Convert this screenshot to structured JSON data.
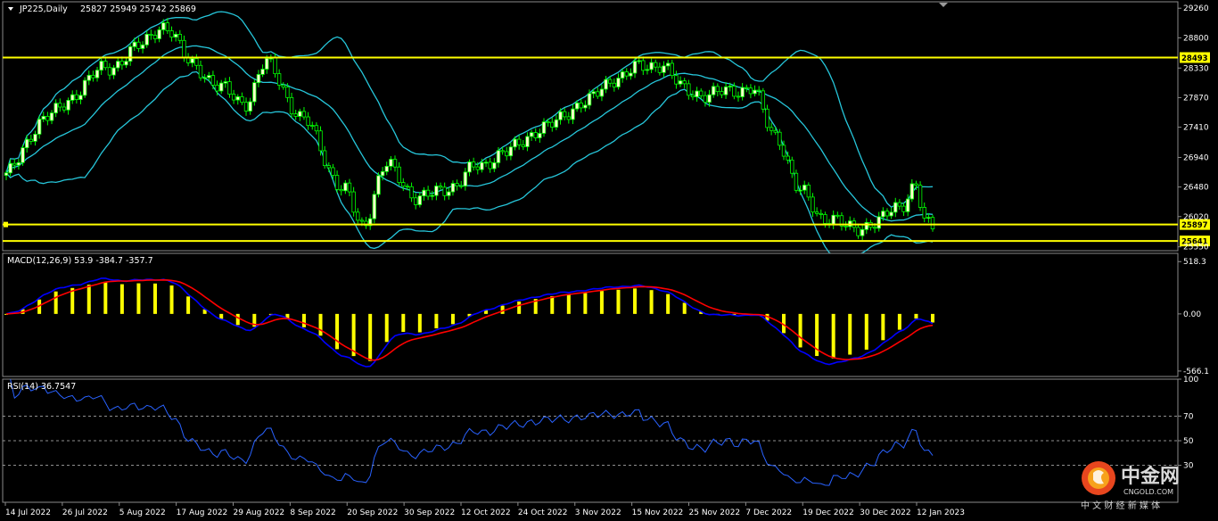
{
  "chart_data": [
    {
      "type": "candlestick",
      "title": "JP225,Daily",
      "ohlc_label": "25827 25949 25742 25869",
      "y_ticks": [
        29260,
        28800,
        28330,
        27870,
        27410,
        26940,
        26480,
        26020,
        25550
      ],
      "ylim": [
        25490,
        29360
      ],
      "levels": [
        {
          "value": 28493,
          "label": "28493"
        },
        {
          "value": 25897,
          "label": "25897"
        },
        {
          "value": 25641,
          "label": "25641"
        }
      ],
      "indicators": [
        "Bollinger Bands"
      ],
      "colors": {
        "bull": "#ffffcc",
        "bear": "#000000",
        "wick": "#00ff00",
        "bands": "#26c6da",
        "level": "#ffff00"
      }
    },
    {
      "type": "line",
      "title": "MACD(12,26,9) 53.9 -384.7 -357.7",
      "y_ticks": [
        {
          "value": 518.3,
          "label": "518.3"
        },
        {
          "value": 0,
          "label": "0.00"
        },
        {
          "value": -566.1,
          "label": "-566.1"
        }
      ],
      "ylim": [
        -620,
        600
      ],
      "series": [
        {
          "name": "histogram",
          "color": "#ffff00"
        },
        {
          "name": "macd",
          "color": "#0000ff"
        },
        {
          "name": "signal",
          "color": "#ff0000"
        }
      ]
    },
    {
      "type": "line",
      "title": "RSI(14) 36.7547",
      "y_ticks": [
        100,
        70,
        50,
        30
      ],
      "ylim": [
        0,
        100
      ],
      "levels": [
        70,
        50,
        30
      ],
      "series": [
        {
          "name": "RSI",
          "color": "#2962ff"
        }
      ]
    }
  ],
  "x_axis": {
    "labels": [
      "14 Jul 2022",
      "26 Jul 2022",
      "5 Aug 2022",
      "17 Aug 2022",
      "29 Aug 2022",
      "8 Sep 2022",
      "20 Sep 2022",
      "30 Sep 2022",
      "12 Oct 2022",
      "24 Oct 2022",
      "3 Nov 2022",
      "15 Nov 2022",
      "25 Nov 2022",
      "7 Dec 2022",
      "19 Dec 2022",
      "30 Dec 2022",
      "12 Jan 2023"
    ]
  },
  "watermark": {
    "brand_cn": "中金网",
    "brand_en": "CNGOLD.COM",
    "slogan": "中 文 财 经 新 媒 体",
    "colors": [
      "#e8461e",
      "#f7a21b"
    ]
  }
}
